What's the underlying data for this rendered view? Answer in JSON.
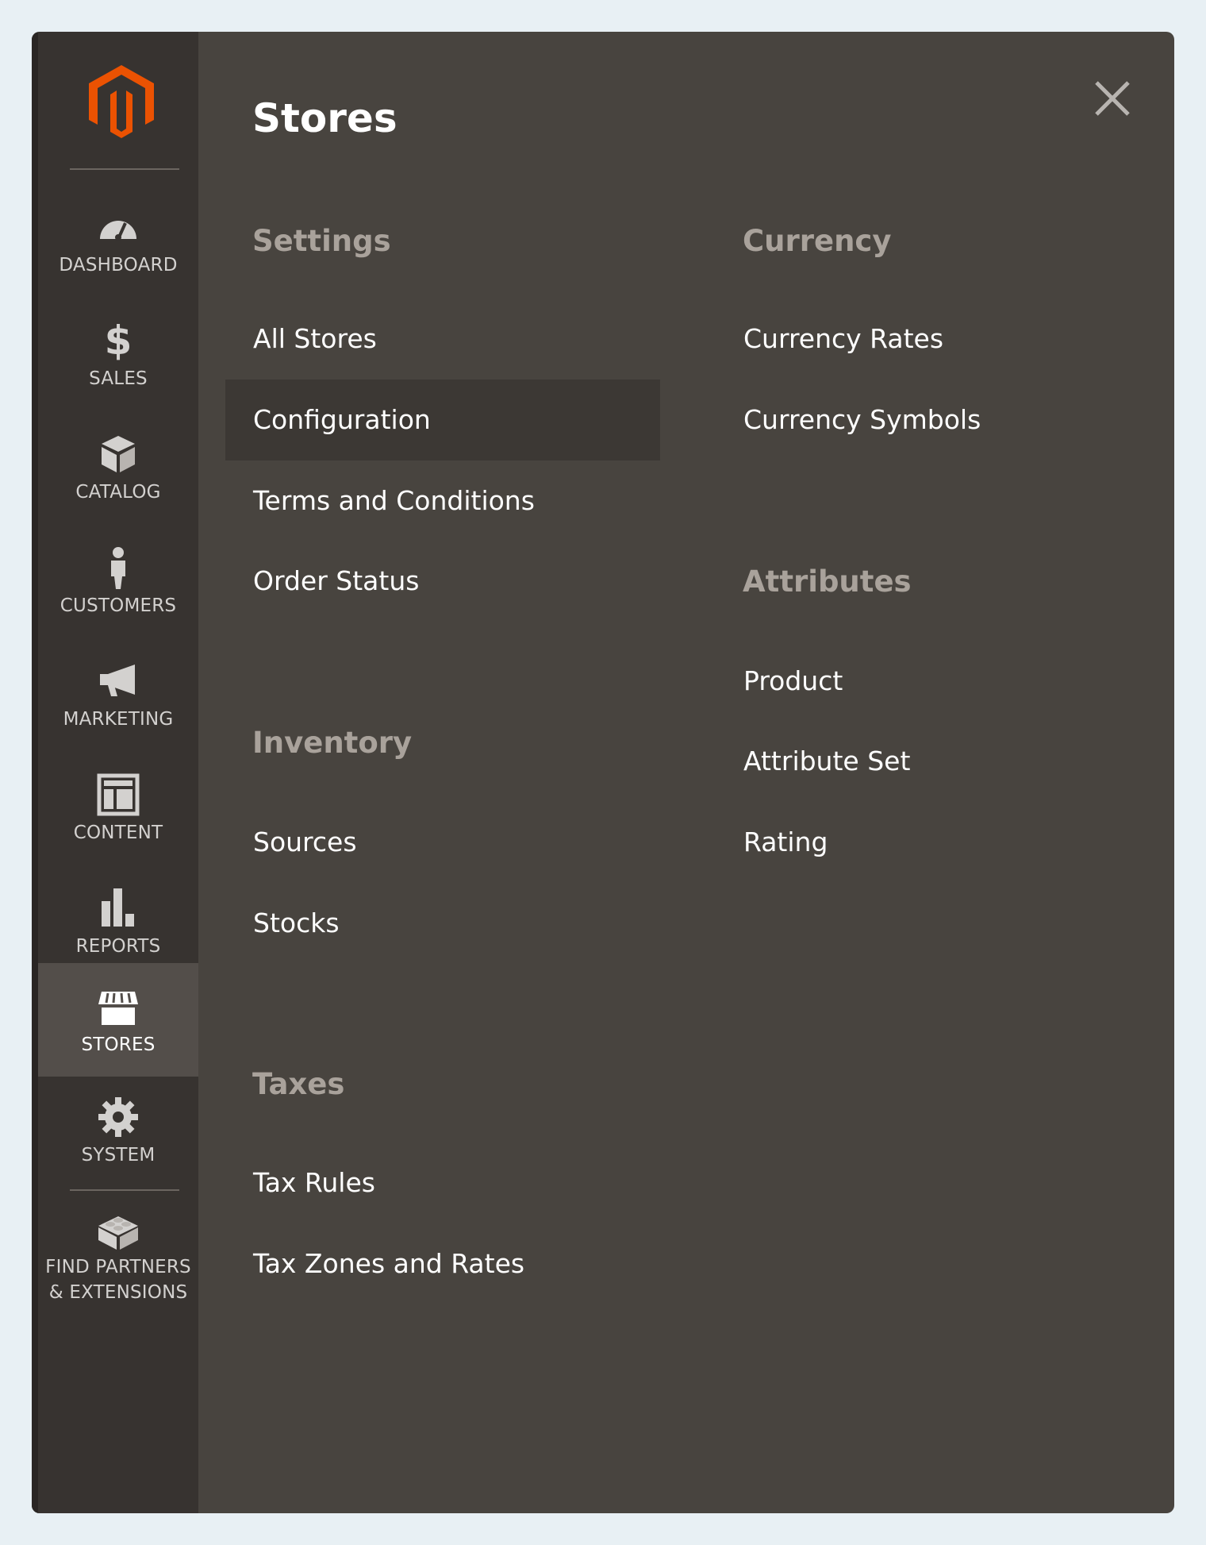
{
  "sidebar": {
    "items": [
      {
        "label": "DASHBOARD",
        "icon": "dashboard-icon"
      },
      {
        "label": "SALES",
        "icon": "dollar-icon"
      },
      {
        "label": "CATALOG",
        "icon": "box-icon"
      },
      {
        "label": "CUSTOMERS",
        "icon": "person-icon"
      },
      {
        "label": "MARKETING",
        "icon": "megaphone-icon"
      },
      {
        "label": "CONTENT",
        "icon": "layout-icon"
      },
      {
        "label": "REPORTS",
        "icon": "bar-chart-icon"
      },
      {
        "label": "STORES",
        "icon": "storefront-icon",
        "active": true
      },
      {
        "label": "SYSTEM",
        "icon": "gear-icon"
      },
      {
        "label_line1": "FIND PARTNERS",
        "label_line2": "& EXTENSIONS",
        "icon": "lego-brick-icon"
      }
    ]
  },
  "panel": {
    "title": "Stores",
    "sections": {
      "settings": {
        "heading": "Settings",
        "links": [
          "All Stores",
          "Configuration",
          "Terms and Conditions",
          "Order Status"
        ],
        "highlighted": "Configuration"
      },
      "inventory": {
        "heading": "Inventory",
        "links": [
          "Sources",
          "Stocks"
        ]
      },
      "taxes": {
        "heading": "Taxes",
        "links": [
          "Tax Rules",
          "Tax Zones and Rates"
        ]
      },
      "currency": {
        "heading": "Currency",
        "links": [
          "Currency Rates",
          "Currency Symbols"
        ]
      },
      "attributes": {
        "heading": "Attributes",
        "links": [
          "Product",
          "Attribute Set",
          "Rating"
        ]
      }
    }
  },
  "colors": {
    "brand": "#eb5202",
    "panel_bg": "#48443f",
    "sidebar_bg": "#373330",
    "active_bg": "#534e4a",
    "heading": "#a9a29b"
  }
}
